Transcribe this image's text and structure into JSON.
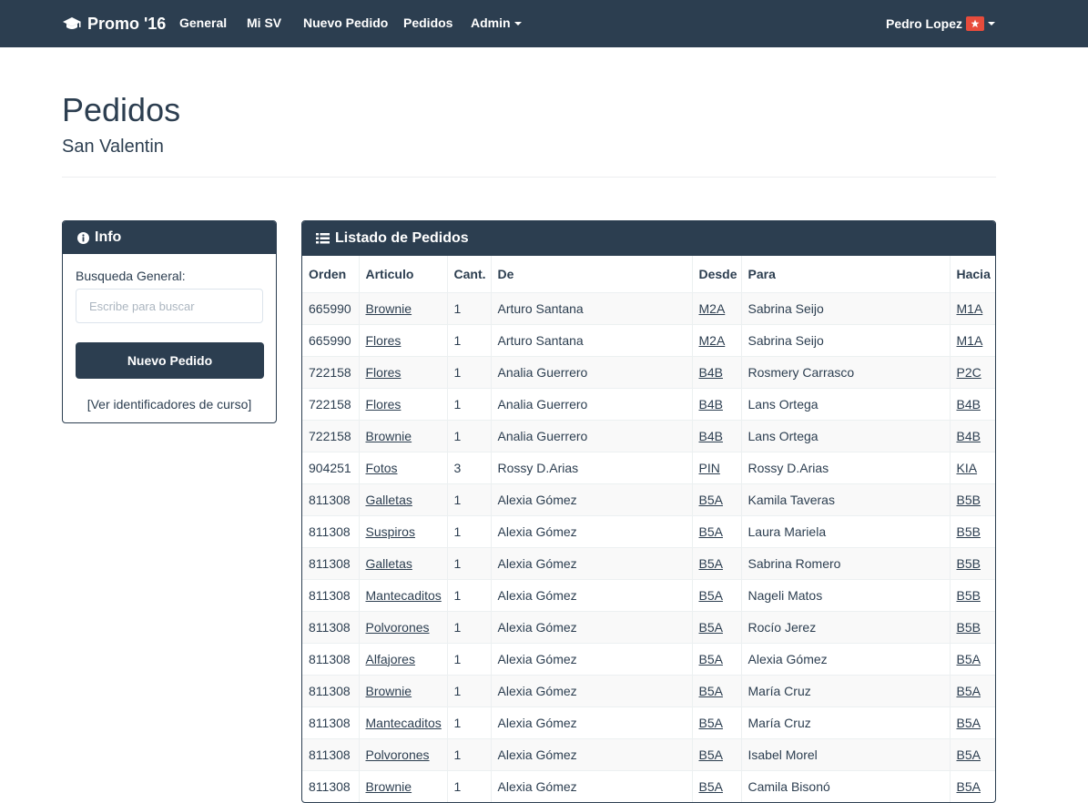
{
  "navbar": {
    "brand": "Promo '16",
    "links": [
      "General",
      "Mi SV",
      "Nuevo Pedido",
      "Pedidos",
      "Admin"
    ],
    "user": "Pedro Lopez",
    "colors": {
      "bg": "#2c3e50",
      "badge": "#e74c3c"
    }
  },
  "page": {
    "title": "Pedidos",
    "subtitle": "San Valentin"
  },
  "info": {
    "heading": "Info",
    "search_label": "Busqueda General:",
    "search_placeholder": "Escribe para buscar",
    "new_order_button": "Nuevo Pedido",
    "course_ids_link": "[Ver identificadores de curso]"
  },
  "orders": {
    "heading": "Listado de Pedidos",
    "columns": [
      "Orden",
      "Articulo",
      "Cant.",
      "De",
      "Desde",
      "Para",
      "Hacia"
    ],
    "rows": [
      [
        "665990",
        "Brownie",
        "1",
        "Arturo Santana",
        "M2A",
        "Sabrina Seijo",
        "M1A"
      ],
      [
        "665990",
        "Flores",
        "1",
        "Arturo Santana",
        "M2A",
        "Sabrina Seijo",
        "M1A"
      ],
      [
        "722158",
        "Flores",
        "1",
        "Analia Guerrero",
        "B4B",
        "Rosmery Carrasco",
        "P2C"
      ],
      [
        "722158",
        "Flores",
        "1",
        "Analia Guerrero",
        "B4B",
        "Lans Ortega",
        "B4B"
      ],
      [
        "722158",
        "Brownie",
        "1",
        "Analia Guerrero",
        "B4B",
        "Lans Ortega",
        "B4B"
      ],
      [
        "904251",
        "Fotos",
        "3",
        "Rossy D.Arias",
        "PIN",
        "Rossy D.Arias",
        "KIA"
      ],
      [
        "811308",
        "Galletas",
        "1",
        "Alexia Gómez",
        "B5A",
        "Kamila Taveras",
        "B5B"
      ],
      [
        "811308",
        "Suspiros",
        "1",
        "Alexia Gómez",
        "B5A",
        "Laura Mariela",
        "B5B"
      ],
      [
        "811308",
        "Galletas",
        "1",
        "Alexia Gómez",
        "B5A",
        "Sabrina Romero",
        "B5B"
      ],
      [
        "811308",
        "Mantecaditos",
        "1",
        "Alexia Gómez",
        "B5A",
        "Nageli Matos",
        "B5B"
      ],
      [
        "811308",
        "Polvorones",
        "1",
        "Alexia Gómez",
        "B5A",
        "Rocío Jerez",
        "B5B"
      ],
      [
        "811308",
        "Alfajores",
        "1",
        "Alexia Gómez",
        "B5A",
        "Alexia Gómez",
        "B5A"
      ],
      [
        "811308",
        "Brownie",
        "1",
        "Alexia Gómez",
        "B5A",
        "María Cruz",
        "B5A"
      ],
      [
        "811308",
        "Mantecaditos",
        "1",
        "Alexia Gómez",
        "B5A",
        "María Cruz",
        "B5A"
      ],
      [
        "811308",
        "Polvorones",
        "1",
        "Alexia Gómez",
        "B5A",
        "Isabel Morel",
        "B5A"
      ],
      [
        "811308",
        "Brownie",
        "1",
        "Alexia Gómez",
        "B5A",
        "Camila Bisonó",
        "B5A"
      ]
    ]
  }
}
